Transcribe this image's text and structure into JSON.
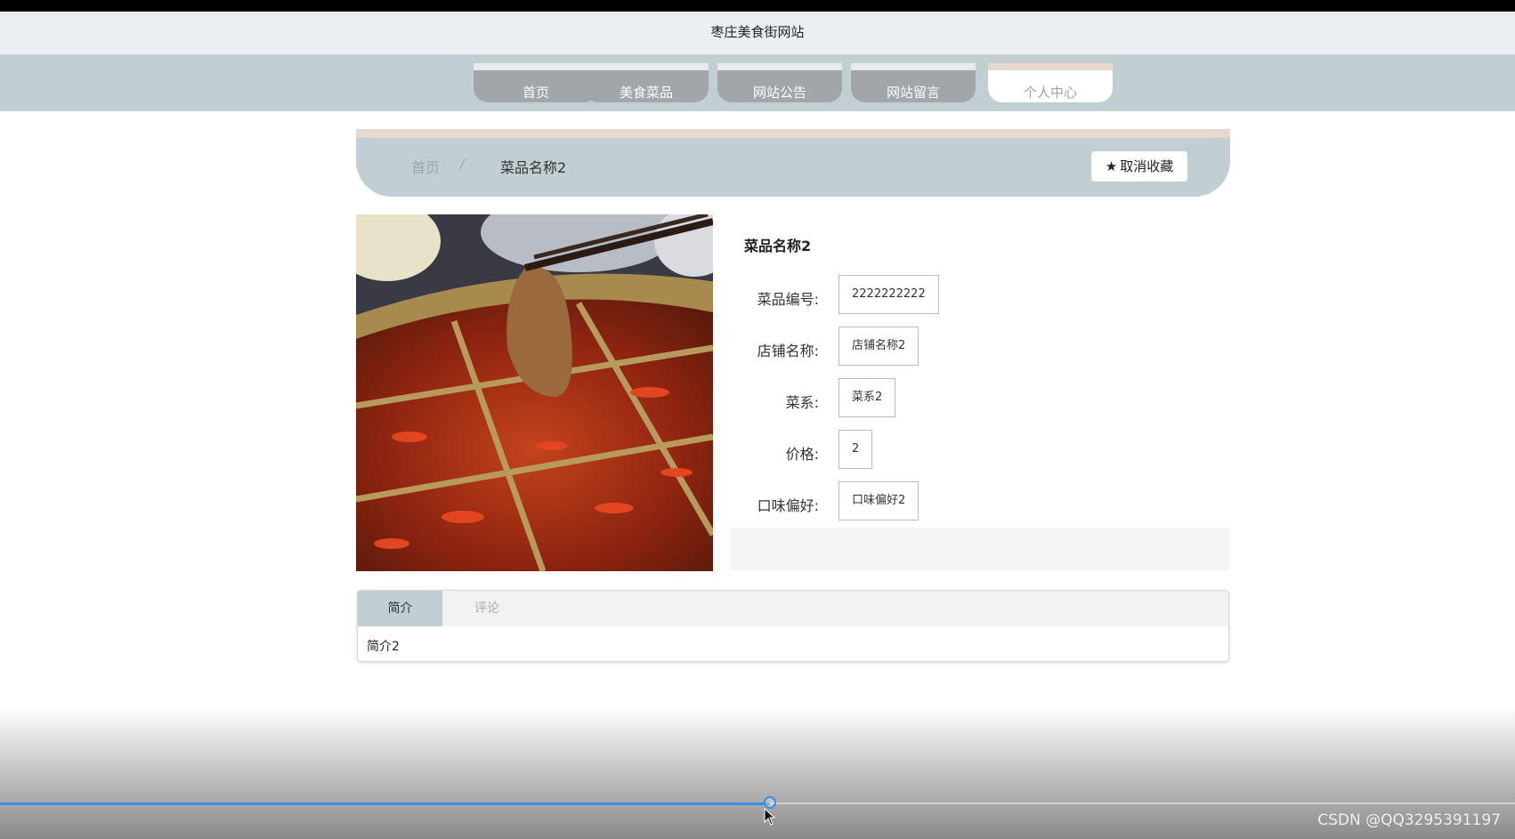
{
  "site": {
    "title": "枣庄美食街网站"
  },
  "nav": {
    "items": [
      {
        "label": "首页",
        "active": false
      },
      {
        "label": "美食菜品",
        "active": false
      },
      {
        "label": "网站公告",
        "active": false
      },
      {
        "label": "网站留言",
        "active": false
      },
      {
        "label": "个人中心",
        "active": true
      }
    ]
  },
  "breadcrumb": {
    "home": "首页",
    "separator": "/",
    "current": "菜品名称2"
  },
  "favorite_button": {
    "icon": "star-icon",
    "label": "取消收藏"
  },
  "dish": {
    "name": "菜品名称2",
    "fields": [
      {
        "label": "菜品编号:",
        "value": "2222222222"
      },
      {
        "label": "店铺名称:",
        "value": "店铺名称2"
      },
      {
        "label": "菜系:",
        "value": "菜系2"
      },
      {
        "label": "价格:",
        "value": "2"
      },
      {
        "label": "口味偏好:",
        "value": "口味偏好2"
      }
    ]
  },
  "tabs": {
    "items": [
      {
        "label": "简介",
        "active": true
      },
      {
        "label": "评论",
        "active": false
      }
    ],
    "content": "简介2"
  },
  "player": {
    "progress": 0.508
  },
  "watermark": "CSDN @QQ3295391197",
  "colors": {
    "nav_bar": "#c1cfd3",
    "nav_item": "#a2a6a8",
    "accent_strip": "#e7d9cf",
    "progress": "#3b8fe0"
  }
}
